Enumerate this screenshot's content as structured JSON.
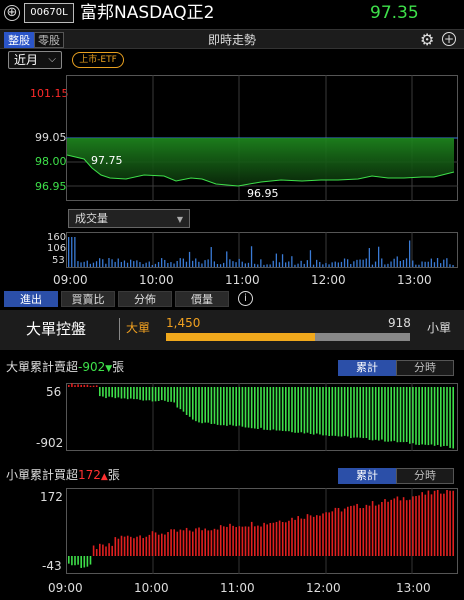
{
  "header": {
    "add_icon": "plus-circle-icon",
    "add_glyph": "⊕",
    "stock_code": "00670L",
    "stock_name": "富邦NASDAQ正2",
    "price": "97.35"
  },
  "tabbar": {
    "tab_whole": "整股",
    "tab_odd": "零股",
    "title": "即時走勢",
    "gear_glyph": "⚙",
    "plus_glyph": "+"
  },
  "controls": {
    "contract": "近月",
    "contract_arrow": "⌵",
    "market_badge": "上市-ETF"
  },
  "price_chart": {
    "y_high": "101.15",
    "y_upper": "99.05",
    "y_ref": "98.00",
    "y_lower": "96.95",
    "label_max": "97.75",
    "label_min": "96.95",
    "line_color": "#3ee04a",
    "ref_line_color": "#3a7bd5"
  },
  "volume": {
    "selector": "成交量",
    "selector_arrow": "▼",
    "y_labels": [
      "160",
      "106",
      "53"
    ]
  },
  "time_axis": [
    "09:00",
    "10:00",
    "11:00",
    "12:00",
    "13:00"
  ],
  "tabs2": {
    "items": [
      "進出",
      "買賣比",
      "分佈",
      "價量"
    ],
    "info_glyph": "i"
  },
  "big_order": {
    "title": "大單控盤",
    "big_label": "大單",
    "small_label": "小單",
    "big_value": "1,450",
    "small_value": "918",
    "big_fraction": 0.612,
    "accent": "#f0a81c"
  },
  "big_net": {
    "title_prefix": "大單累計賣超",
    "value": "-902",
    "unit": "張",
    "btn_cumulative": "累計",
    "btn_intraday": "分時",
    "y_max_label": "56",
    "y_min_label": "-902",
    "color_up": "#e02020",
    "color_down": "#3ee04a"
  },
  "small_net": {
    "title_prefix": "小單累計買超",
    "value": "172",
    "unit": "張",
    "btn_cumulative": "累計",
    "btn_intraday": "分時",
    "y_max_label": "172",
    "y_min_label": "-43",
    "color_up": "#e02020",
    "color_down": "#3ee04a"
  }
}
